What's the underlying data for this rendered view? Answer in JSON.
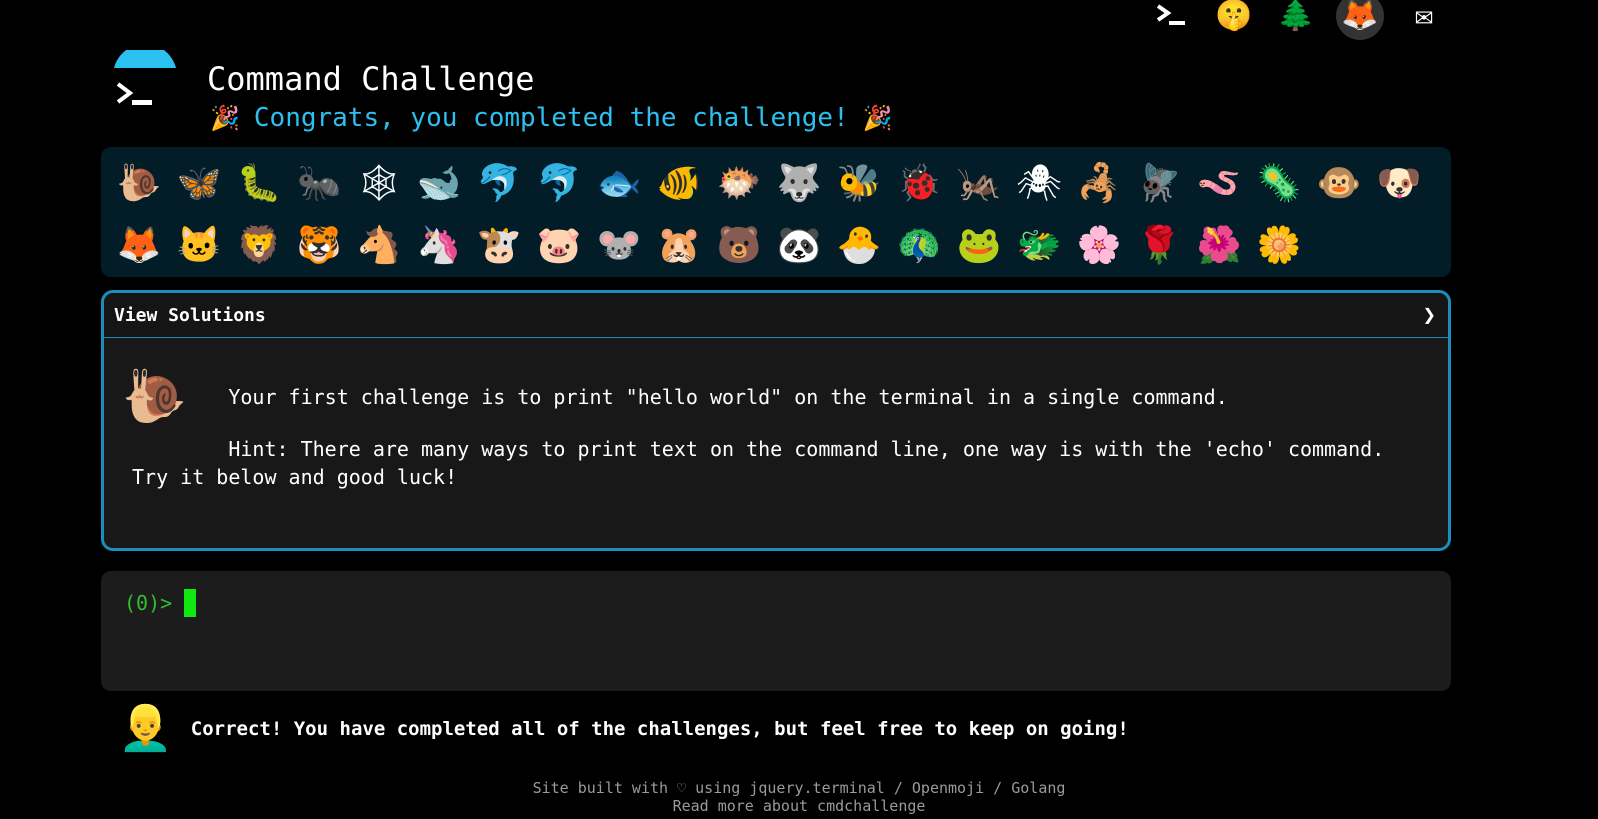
{
  "header": {
    "title": "Command Challenge",
    "congrats": "Congrats, you completed the challenge!",
    "party_emoji": "🎉"
  },
  "top_icons": [
    {
      "name": "terminal-icon",
      "glyph": ""
    },
    {
      "name": "shushing-face-icon",
      "glyph": "🤫"
    },
    {
      "name": "tree-icon",
      "glyph": "🌲"
    },
    {
      "name": "gitlab-fox-icon",
      "glyph": "🦊"
    },
    {
      "name": "envelope-icon",
      "glyph": "✉"
    }
  ],
  "badges": [
    "🐌",
    "🦋",
    "🐛",
    "🐜",
    "🕸",
    "🐋",
    "🐬",
    "🐬",
    "🐟",
    "🐠",
    "🐡",
    "🐺",
    "🐝",
    "🐞",
    "🦗",
    "🕷",
    "🦂",
    "🪰",
    "🪱",
    "🦠",
    "🐵",
    "🐶",
    "🦊",
    "🐱",
    "🦁",
    "🐯",
    "🐴",
    "🦄",
    "🐮",
    "🐷",
    "🐭",
    "🐹",
    "🐻",
    "🐼",
    "🐣",
    "🦚",
    "🐸",
    "🐲",
    "🌸",
    "🌹",
    "🌺",
    "🌼"
  ],
  "solutions": {
    "toggle_label": "View Solutions",
    "chevron": "❯",
    "challenge_emoji": "🐌",
    "description": "        Your first challenge is to print \"hello world\" on the terminal in a single command.",
    "hint": "        Hint: There are many ways to print text on the command line, one way is with the 'echo' command. Try it below and good luck!"
  },
  "terminal": {
    "prompt": "(0)>"
  },
  "message": {
    "avatar": "👱‍♂️",
    "text": "Correct! You have completed all of the challenges, but feel free to keep on going!"
  },
  "footer": {
    "built_prefix": "Site built with ♡ using ",
    "link_jquery": "jquery.terminal",
    "sep1": " / ",
    "link_openmoji": "Openmoji",
    "sep2": " / ",
    "link_golang": "Golang",
    "read_more": "Read more about cmdchallenge"
  },
  "colors": {
    "accent": "#2bc0f0",
    "panel_border": "#1a8fb8",
    "badge_bg": "#021c28",
    "prompt": "#2fbf2f",
    "cursor": "#11e811"
  }
}
